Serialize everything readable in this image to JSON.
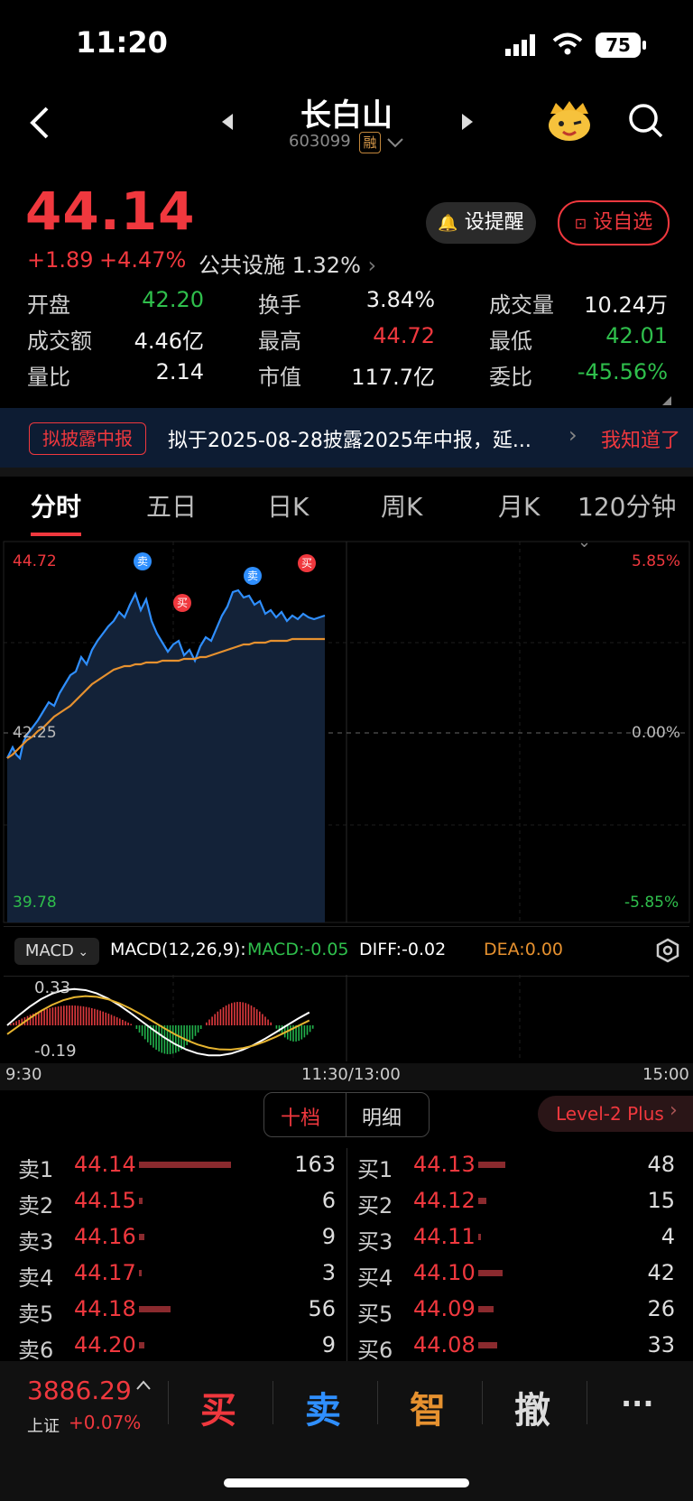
{
  "status": {
    "time": "11:20",
    "battery": "75"
  },
  "header": {
    "title": "长白山",
    "code": "603099",
    "margin_badge": "融"
  },
  "quote": {
    "price": "44.14",
    "change": "+1.89",
    "change_pct": "+4.47%",
    "sector": "公共设施",
    "sector_pct": "1.32%",
    "remind_label": "设提醒",
    "watch_label": "设自选",
    "stats": [
      {
        "k": "开盘",
        "v": "42.20",
        "c": "green"
      },
      {
        "k": "换手",
        "v": "3.84%",
        "c": "white"
      },
      {
        "k": "成交量",
        "v": "10.24万",
        "c": "white"
      },
      {
        "k": "成交额",
        "v": "4.46亿",
        "c": "white"
      },
      {
        "k": "最高",
        "v": "44.72",
        "c": "red"
      },
      {
        "k": "最低",
        "v": "42.01",
        "c": "green"
      },
      {
        "k": "量比",
        "v": "2.14",
        "c": "white"
      },
      {
        "k": "市值",
        "v": "117.7亿",
        "c": "white"
      },
      {
        "k": "委比",
        "v": "-45.56%",
        "c": "green"
      }
    ]
  },
  "notice": {
    "badge": "拟披露中报",
    "text": "拟于2025-08-28披露2025年中报，延...",
    "action": "我知道了"
  },
  "tabs": [
    "分时",
    "五日",
    "日K",
    "周K",
    "月K",
    "120分钟"
  ],
  "chart_labels": {
    "high": "44.72",
    "high_pct": "5.85%",
    "base": "42.25",
    "base_pct": "0.00%",
    "low": "39.78",
    "low_pct": "-5.85%",
    "sell": "卖",
    "buy": "买"
  },
  "macd": {
    "selector": "MACD",
    "name": "MACD(12,26,9):",
    "macd": "MACD:-0.05",
    "diff": "DIFF:-0.02",
    "dea": "DEA:0.00",
    "top": "0.33",
    "bottom": "-0.19"
  },
  "time_axis": [
    "9:30",
    "11:30/13:00",
    "15:00"
  ],
  "orderbook": {
    "tab_levels": "十档",
    "tab_detail": "明细",
    "level2": "Level-2 Plus",
    "asks": [
      {
        "l": "卖1",
        "p": "44.14",
        "q": "163",
        "w": 0.98
      },
      {
        "l": "卖2",
        "p": "44.15",
        "q": "6",
        "w": 0.04
      },
      {
        "l": "卖3",
        "p": "44.16",
        "q": "9",
        "w": 0.06
      },
      {
        "l": "卖4",
        "p": "44.17",
        "q": "3",
        "w": 0.02
      },
      {
        "l": "卖5",
        "p": "44.18",
        "q": "56",
        "w": 0.34
      },
      {
        "l": "卖6",
        "p": "44.20",
        "q": "9",
        "w": 0.06
      }
    ],
    "bids": [
      {
        "l": "买1",
        "p": "44.13",
        "q": "48",
        "w": 0.29
      },
      {
        "l": "买2",
        "p": "44.12",
        "q": "15",
        "w": 0.09
      },
      {
        "l": "买3",
        "p": "44.11",
        "q": "4",
        "w": 0.03
      },
      {
        "l": "买4",
        "p": "44.10",
        "q": "42",
        "w": 0.26
      },
      {
        "l": "买5",
        "p": "44.09",
        "q": "26",
        "w": 0.16
      },
      {
        "l": "买6",
        "p": "44.08",
        "q": "33",
        "w": 0.2
      }
    ]
  },
  "bottom": {
    "index_value": "3886.29",
    "index_name": "上证",
    "index_pct": "+0.07%",
    "buy": "买",
    "sell": "卖",
    "smart": "智",
    "cancel": "撤",
    "more": "···"
  },
  "colors": {
    "red": "#f0383e",
    "green": "#2fbf4c",
    "blue": "#2f8fff",
    "orange": "#e6912f"
  }
}
